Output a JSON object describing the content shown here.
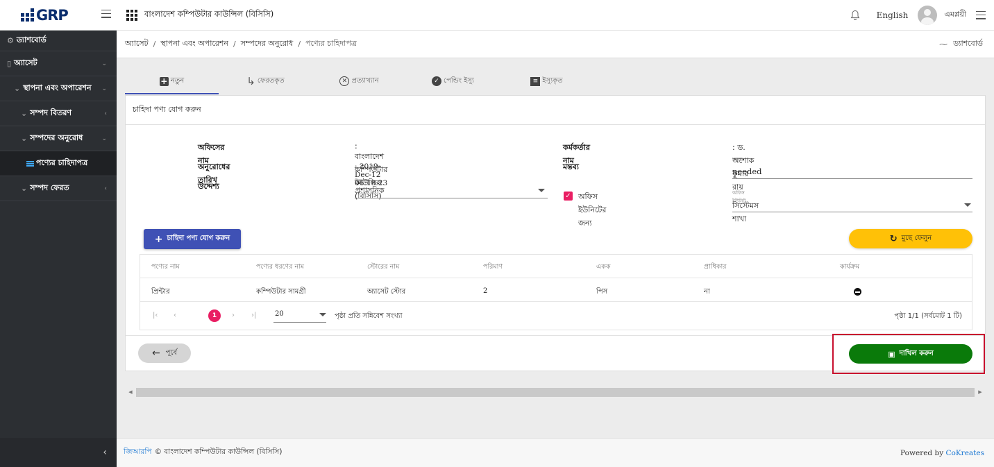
{
  "app": {
    "logo_text": "GRP",
    "org_title": "বাংলাদেশ কম্পিউটার কাউন্সিল (বিসিসি)",
    "language": "English",
    "user_name": "এমপ্লয়ী"
  },
  "sidebar": {
    "items": [
      {
        "label": "ড্যাশবোর্ড"
      },
      {
        "label": "অ্যাসেট"
      },
      {
        "label": "স্থাপনা এবং অপারেশন"
      },
      {
        "label": "সম্পদ বিতরণ"
      },
      {
        "label": "সম্পদের অনুরোধ"
      },
      {
        "label": "পণ্যের চাহিদাপত্র"
      },
      {
        "label": "সম্পদ ফেরত"
      }
    ],
    "collapse_glyph": "‹"
  },
  "breadcrumb": {
    "items": [
      "অ্যাসেট",
      "স্থাপনা এবং অপারেশন",
      "সম্পদের অনুরোধ",
      "পণ্যের চাহিদাপত্র"
    ],
    "separator": "/",
    "right_link": "ড্যাশবোর্ড"
  },
  "tabs": [
    {
      "label": "নতুন",
      "active": true
    },
    {
      "label": "ফেরতকৃত",
      "active": false
    },
    {
      "label": "প্রত্যাখ্যান",
      "active": false
    },
    {
      "label": "পেন্ডিং ইস্যু",
      "active": false
    },
    {
      "label": "ইস্যুকৃত",
      "active": false
    }
  ],
  "form": {
    "title": "চাহিদা পণ্য যোগ করুন",
    "office_name_label": "অফিসের নাম",
    "office_name_value": ": বাংলাদেশ কম্পিউটার কাউন্সিল (বিসিসি)",
    "request_date_label": "অনুরোধের তারিখ",
    "request_date_value": ": 2019-Dec-12 06:18:23",
    "purpose_label": "উদ্দেশ্য",
    "purpose_field_label": "উদ্দেশ্য",
    "purpose_value": "প্রশাসনিক",
    "officer_label": "কর্মকর্তার নাম",
    "officer_value": ": ড. অশোক কুমার রায়",
    "comment_label": "মন্তব্য",
    "comment_field_label": "মন্তব্য",
    "comment_value": "needed",
    "office_unit_checkbox_label": "অফিস ইউনিটের জন্য",
    "office_unit_checked": true,
    "office_unit_field_label": "অফিস ইউনিট",
    "office_unit_value": "সিস্টেমস শাখা"
  },
  "actions": {
    "add_label": "চাহিদা পণ্য যোগ করুন",
    "clear_label": "মুছে ফেলুন",
    "prev_label": "পূর্বে",
    "submit_label": "দাখিল করুন"
  },
  "table": {
    "headers": [
      "পণ্যের নাম",
      "পণ্যের ধরণের নাম",
      "স্টোরের নাম",
      "পরিমাণ",
      "একক",
      "প্রাধিকার",
      "কার্যক্রম"
    ],
    "rows": [
      {
        "product": "প্রিন্টার",
        "type": "কম্পিউটার সামগ্রী",
        "store": "অ্যাসেট স্টোর",
        "qty": "2",
        "unit": "পিস",
        "priority": "না"
      }
    ]
  },
  "pagination": {
    "current_page": "1",
    "page_size": "20",
    "page_size_label": "পৃষ্ঠা প্রতি সন্নিবেশ সংখ্যা",
    "info": "পৃষ্ঠা 1/1 (সর্বমোট 1 টি)"
  },
  "footer": {
    "brand": "জিআরপি",
    "copyright": "© বাংলাদেশ কম্পিউটার কাউন্সিল (বিসিসি)",
    "powered_by": "Powered by",
    "powered_link": "CoKreates"
  },
  "colors": {
    "primary": "#3f51b5",
    "accent_pink": "#e91e63",
    "warning": "#ffc107",
    "success": "#0a7a0a",
    "highlight_frame": "#c8102e",
    "sidebar_bg": "#2c2f33",
    "link": "#1976d2"
  },
  "icons": {
    "bell": "bell-icon",
    "apps": "apps-grid-icon",
    "menu": "menu-icon",
    "tab_new": "plus-box-icon",
    "tab_returned": "return-arrow-icon",
    "tab_rejected": "close-circle-icon",
    "tab_pending": "check-circle-icon",
    "tab_issued": "document-icon",
    "remove_row": "minus-circle-icon"
  }
}
